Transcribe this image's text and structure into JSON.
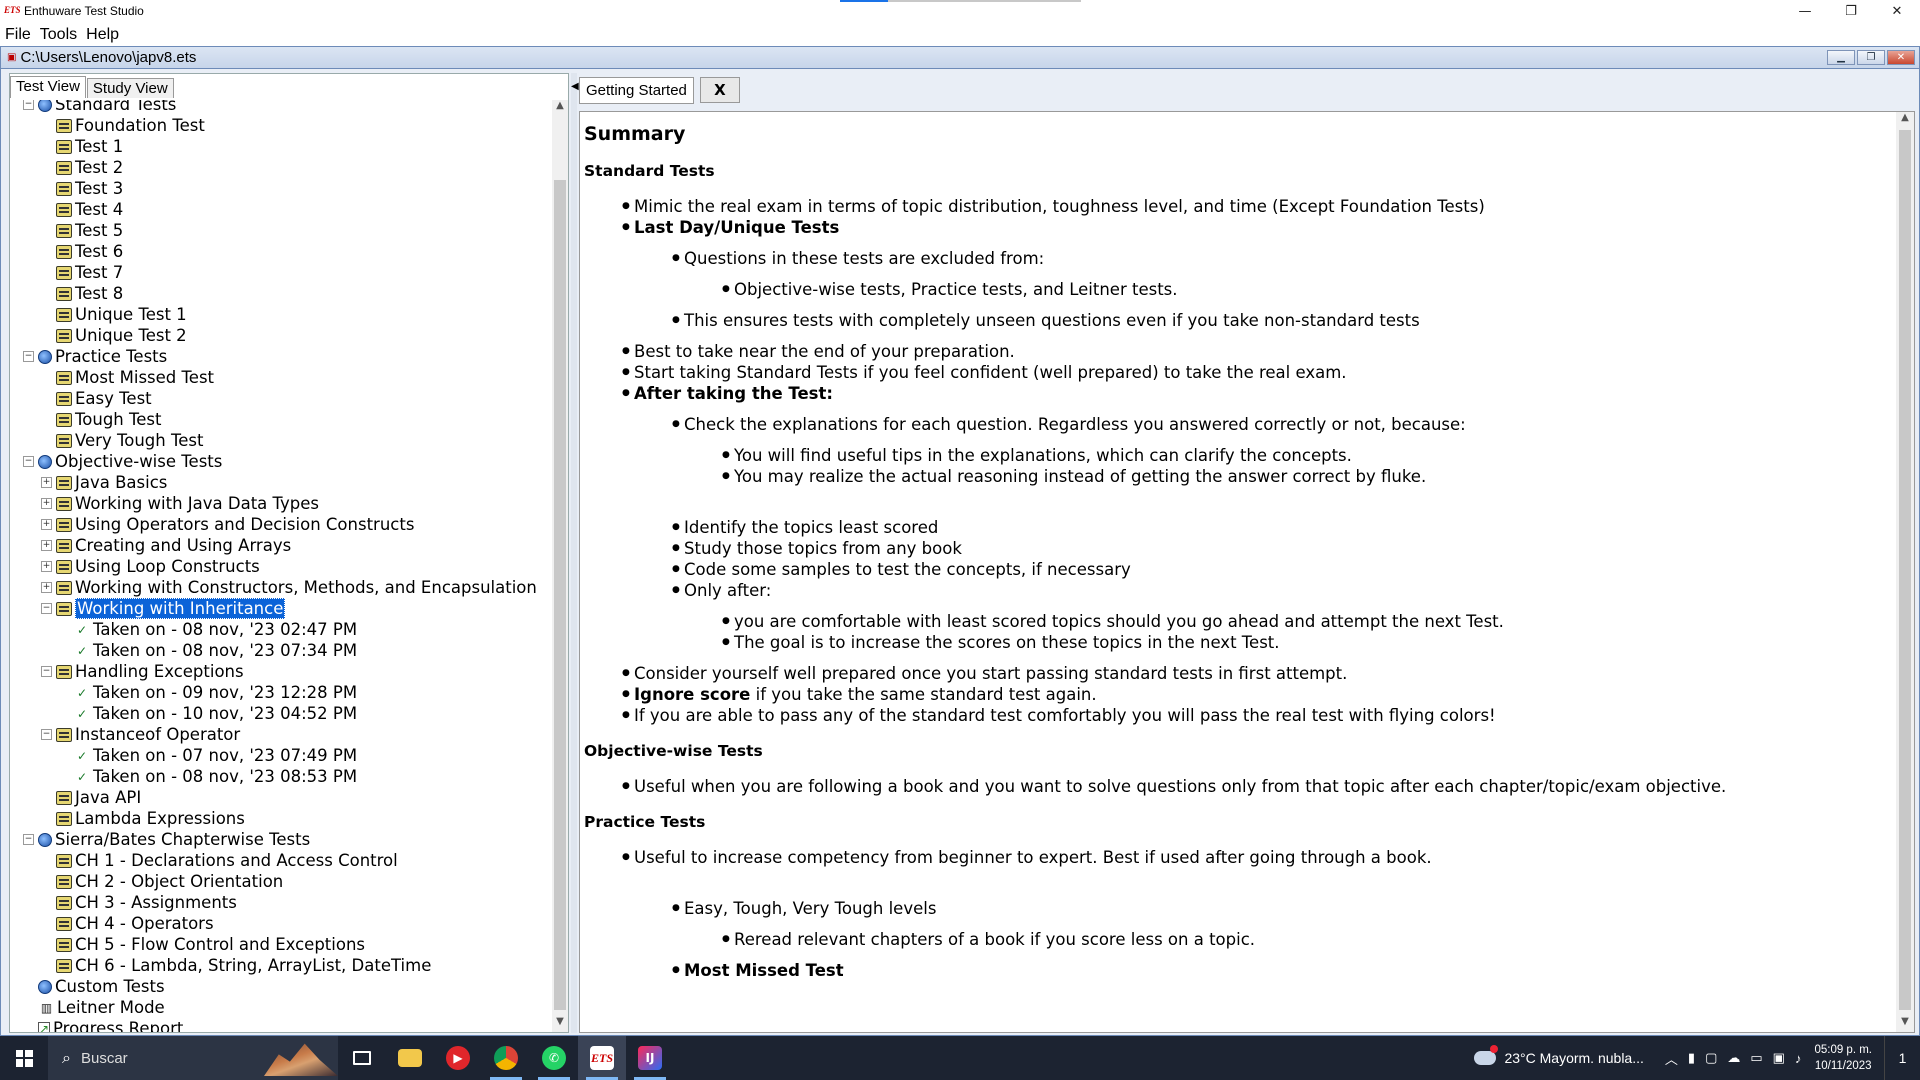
{
  "window": {
    "app_title": "Enthuware Test Studio",
    "minimize": "—",
    "maximize": "❐",
    "close": "✕"
  },
  "menu": [
    "File",
    "Tools",
    "Help"
  ],
  "doc": {
    "path": "C:\\Users\\Lenovo\\japv8.ets"
  },
  "left_tabs": [
    "Test View",
    "Study View"
  ],
  "tree": [
    {
      "label": "Standard Tests",
      "icon": "group",
      "level": 0,
      "toggle": "−"
    },
    {
      "label": "Foundation Test",
      "icon": "test",
      "level": 1
    },
    {
      "label": "Test 1",
      "icon": "test",
      "level": 1
    },
    {
      "label": "Test 2",
      "icon": "test",
      "level": 1
    },
    {
      "label": "Test 3",
      "icon": "test",
      "level": 1
    },
    {
      "label": "Test 4",
      "icon": "test",
      "level": 1
    },
    {
      "label": "Test 5",
      "icon": "test",
      "level": 1
    },
    {
      "label": "Test 6",
      "icon": "test",
      "level": 1
    },
    {
      "label": "Test 7",
      "icon": "test",
      "level": 1
    },
    {
      "label": "Test 8",
      "icon": "test",
      "level": 1
    },
    {
      "label": "Unique Test 1",
      "icon": "test",
      "level": 1
    },
    {
      "label": "Unique Test 2",
      "icon": "test",
      "level": 1
    },
    {
      "label": "Practice Tests",
      "icon": "group",
      "level": 0,
      "toggle": "−"
    },
    {
      "label": "Most Missed Test",
      "icon": "test",
      "level": 1
    },
    {
      "label": "Easy Test",
      "icon": "test",
      "level": 1
    },
    {
      "label": "Tough Test",
      "icon": "test",
      "level": 1
    },
    {
      "label": "Very Tough Test",
      "icon": "test",
      "level": 1
    },
    {
      "label": "Objective-wise Tests",
      "icon": "group",
      "level": 0,
      "toggle": "−"
    },
    {
      "label": "Java Basics",
      "icon": "test",
      "level": 1,
      "toggle": "+"
    },
    {
      "label": "Working with Java Data Types",
      "icon": "test",
      "level": 1,
      "toggle": "+"
    },
    {
      "label": "Using Operators and Decision Constructs",
      "icon": "test",
      "level": 1,
      "toggle": "+"
    },
    {
      "label": "Creating and Using Arrays",
      "icon": "test",
      "level": 1,
      "toggle": "+"
    },
    {
      "label": "Using Loop Constructs",
      "icon": "test",
      "level": 1,
      "toggle": "+"
    },
    {
      "label": "Working with Constructors, Methods, and Encapsulation",
      "icon": "test",
      "level": 1,
      "toggle": "+"
    },
    {
      "label": "Working with Inheritance",
      "icon": "test",
      "level": 1,
      "toggle": "−",
      "selected": true
    },
    {
      "label": "Taken on - 08 nov, '23 02:47 PM",
      "icon": "taken",
      "level": 2
    },
    {
      "label": "Taken on - 08 nov, '23 07:34 PM",
      "icon": "taken",
      "level": 2
    },
    {
      "label": "Handling Exceptions",
      "icon": "test",
      "level": 1,
      "toggle": "−"
    },
    {
      "label": "Taken on - 09 nov, '23 12:28 PM",
      "icon": "taken",
      "level": 2
    },
    {
      "label": "Taken on - 10 nov, '23 04:52 PM",
      "icon": "taken",
      "level": 2
    },
    {
      "label": "Instanceof Operator",
      "icon": "test",
      "level": 1,
      "toggle": "−"
    },
    {
      "label": "Taken on - 07 nov, '23 07:49 PM",
      "icon": "taken",
      "level": 2
    },
    {
      "label": "Taken on - 08 nov, '23 08:53 PM",
      "icon": "taken",
      "level": 2
    },
    {
      "label": "Java API",
      "icon": "test",
      "level": 1
    },
    {
      "label": "Lambda Expressions",
      "icon": "test",
      "level": 1
    },
    {
      "label": "Sierra/Bates Chapterwise Tests",
      "icon": "group",
      "level": 0,
      "toggle": "−"
    },
    {
      "label": "CH 1 - Declarations and Access Control",
      "icon": "test",
      "level": 1
    },
    {
      "label": "CH 2 - Object Orientation",
      "icon": "test",
      "level": 1
    },
    {
      "label": "CH 3 - Assignments",
      "icon": "test",
      "level": 1
    },
    {
      "label": "CH 4 - Operators",
      "icon": "test",
      "level": 1
    },
    {
      "label": "CH 5 - Flow Control and Exceptions",
      "icon": "test",
      "level": 1
    },
    {
      "label": "CH 6 - Lambda, String, ArrayList, DateTime",
      "icon": "test",
      "level": 1
    },
    {
      "label": "Custom Tests",
      "icon": "group",
      "level": 0
    },
    {
      "label": "Leitner Mode",
      "icon": "leitner",
      "level": 0
    },
    {
      "label": "Progress Report",
      "icon": "report",
      "level": 0
    }
  ],
  "right_tab": {
    "label": "Getting Started",
    "close": "X"
  },
  "summary": {
    "title": "Summary",
    "standard_heading": "Standard Tests",
    "s1": "Mimic the real exam in terms of topic distribution, toughness level, and time (Except Foundation Tests)",
    "s2": "Last Day/Unique Tests",
    "s2a": "Questions in these tests are excluded from:",
    "s2a1": "Objective-wise tests, Practice tests, and Leitner tests.",
    "s2b": "This ensures tests with completely unseen questions even if you take non-standard tests",
    "s3": "Best to take near the end of your preparation.",
    "s4": "Start taking Standard Tests if you feel confident (well prepared) to take the real exam.",
    "s5": "After taking the Test:",
    "s5a": "Check the explanations for each question. Regardless you answered correctly or not, because:",
    "s5a1": "You will find useful tips in the explanations, which can clarify the concepts.",
    "s5a2": "You may realize the actual reasoning instead of getting the answer correct by fluke.",
    "s5b": "Identify the topics least scored",
    "s5c": "Study those topics from any book",
    "s5d": "Code some samples to test the concepts, if necessary",
    "s5e": "Only after:",
    "s5e1": "you are comfortable with least scored topics should you go ahead and attempt the next Test.",
    "s5e2": "The goal is to increase the scores on these topics in the next Test.",
    "s6": "Consider yourself well prepared once you start passing standard tests in first attempt.",
    "s7_bold": "Ignore score",
    "s7_rest": " if you take the same standard test again.",
    "s8": "If you are able to pass any of the standard test comfortably you will pass the real test with flying colors!",
    "objective_heading": "Objective-wise Tests",
    "o1": "Useful when you are following a book and you want to solve questions only from that topic after each chapter/topic/exam objective.",
    "practice_heading": "Practice Tests",
    "p1": "Useful to increase competency from beginner to expert. Best if used after going through a book.",
    "p2": "Easy, Tough, Very Tough levels",
    "p2a": "Reread relevant chapters of a book if you score less on a topic.",
    "p3": "Most Missed Test"
  },
  "taskbar": {
    "search_placeholder": "Buscar",
    "weather": "23°C  Mayorm. nubla...",
    "time": "05:09 p. m.",
    "date": "10/11/2023",
    "notif_count": "1"
  }
}
